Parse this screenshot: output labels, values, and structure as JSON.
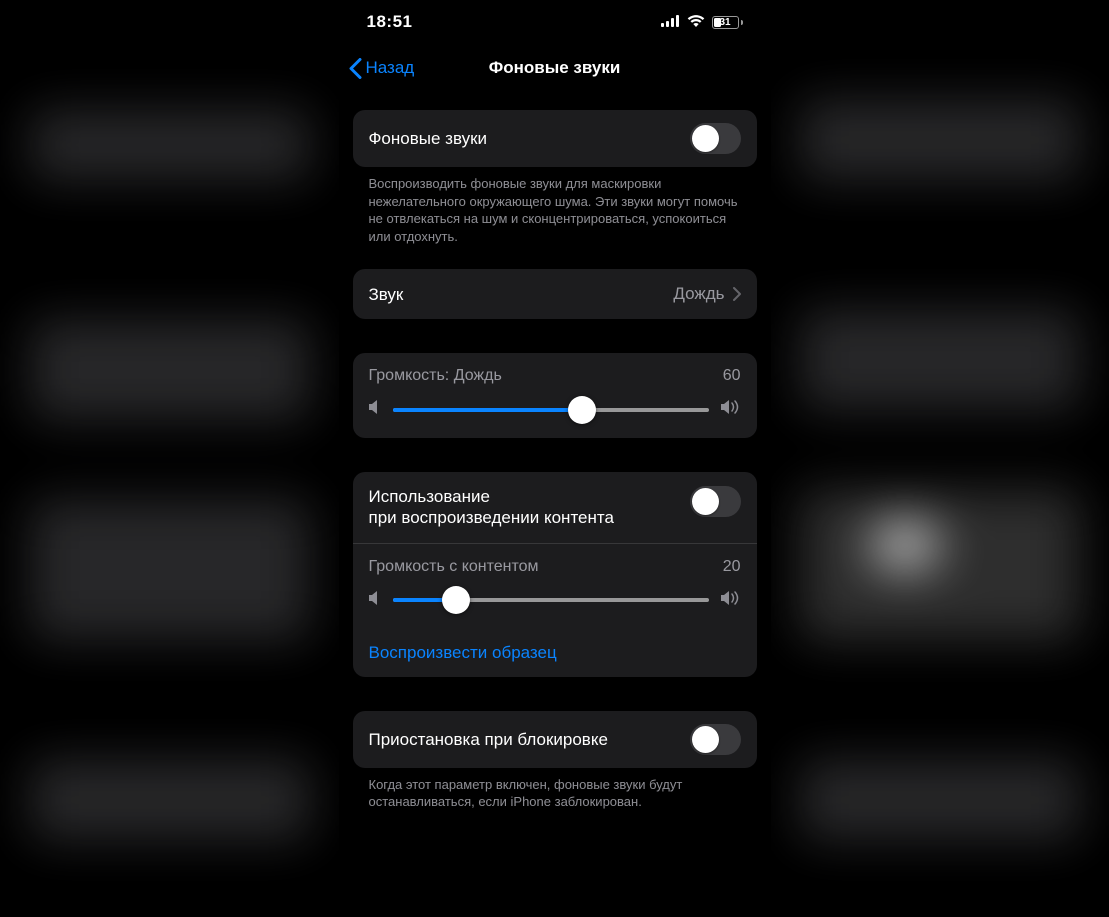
{
  "statusbar": {
    "time": "18:51",
    "battery_percent": 31
  },
  "nav": {
    "back_label": "Назад",
    "title": "Фоновые звуки"
  },
  "main_toggle": {
    "label": "Фоновые звуки",
    "footer": "Воспроизводить фоновые звуки для маскировки нежелательного окружающего шума. Эти звуки могут помочь не отвлекаться на шум и сконцентрироваться, успокоиться или отдохнуть."
  },
  "sound_row": {
    "label": "Звук",
    "value": "Дождь"
  },
  "volume1": {
    "label": "Громкость: Дождь",
    "value": 60
  },
  "media_group": {
    "toggle_label": "Использование\nпри воспроизведении контента",
    "volume_label": "Громкость с контентом",
    "volume_value": 20,
    "sample_label": "Воспроизвести образец"
  },
  "lock_group": {
    "label": "Приостановка при блокировке",
    "footer": "Когда этот параметр включен, фоновые звуки будут останавливаться, если iPhone заблокирован."
  },
  "colors": {
    "accent": "#0a84ff"
  }
}
